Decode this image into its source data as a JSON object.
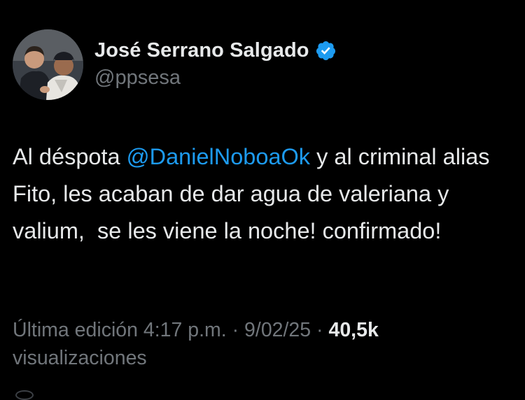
{
  "author": {
    "display_name": "José Serrano Salgado",
    "handle": "@ppsesa",
    "verified_icon": "verified-badge-icon",
    "verified_color": "#1d9bf0"
  },
  "tweet": {
    "text_part1": "Al déspota ",
    "mention": "@DanielNoboaOk",
    "text_part2": " y al criminal alias Fito, les acaban de dar agua de valeriana y valium,  se les viene la noche! confirmado!",
    "mention_color": "#1d9bf0"
  },
  "meta": {
    "edited_label": "Última edición 4:17 p.m. · 9/02/25",
    "separator": " · ",
    "views_count": "40,5k",
    "views_label": "visualizaciones"
  },
  "colors": {
    "background": "#000000",
    "primary_text": "#e7e9ea",
    "secondary_text": "#71767b"
  }
}
